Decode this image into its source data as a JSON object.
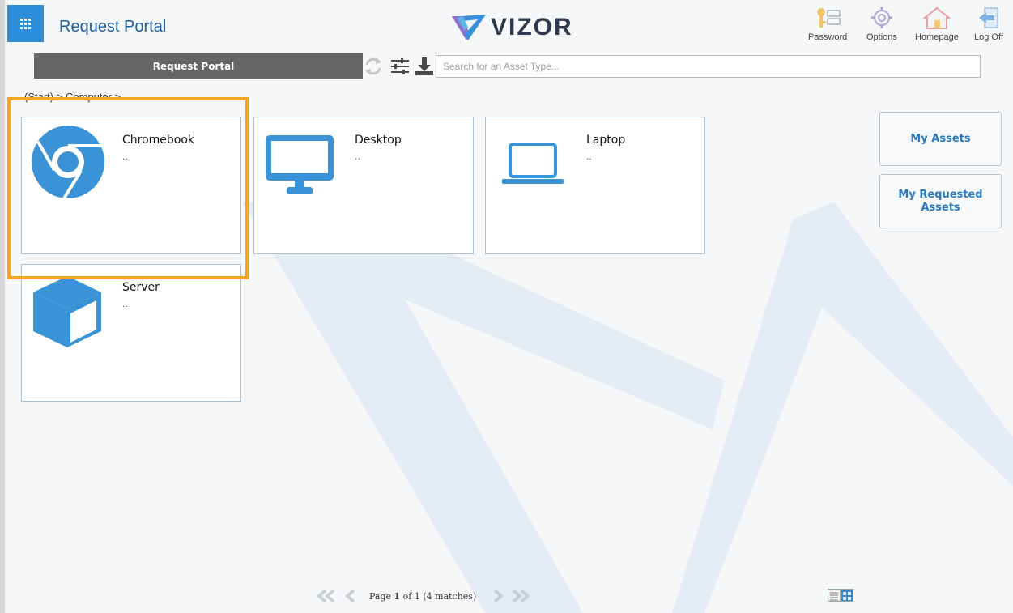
{
  "header": {
    "app_title": "Request Portal",
    "logo_text": "VIZOR",
    "actions": [
      {
        "label": "Password",
        "icon": "key-icon"
      },
      {
        "label": "Options",
        "icon": "gear-icon"
      },
      {
        "label": "Homepage",
        "icon": "home-icon"
      },
      {
        "label": "Log Off",
        "icon": "logoff-icon"
      }
    ]
  },
  "toolbar": {
    "tab_label": "Request Portal",
    "search_placeholder": "Search for an Asset Type..."
  },
  "breadcrumb": "(Start) > Computer >",
  "cards": [
    {
      "title": "Chromebook",
      "desc": "..",
      "icon": "chrome-icon"
    },
    {
      "title": "Desktop",
      "desc": "..",
      "icon": "monitor-icon"
    },
    {
      "title": "Laptop",
      "desc": "..",
      "icon": "laptop-icon"
    },
    {
      "title": "Server",
      "desc": "..",
      "icon": "cube-icon"
    }
  ],
  "side": {
    "my_assets": "My Assets",
    "my_requested_assets": "My Requested Assets"
  },
  "pager": {
    "page_prefix": "Page ",
    "page_current": "1",
    "page_suffix": " of 1 (4 matches)"
  },
  "colors": {
    "accent": "#2d8fd9",
    "highlight": "#f5a623",
    "tab_bar": "#666666"
  }
}
